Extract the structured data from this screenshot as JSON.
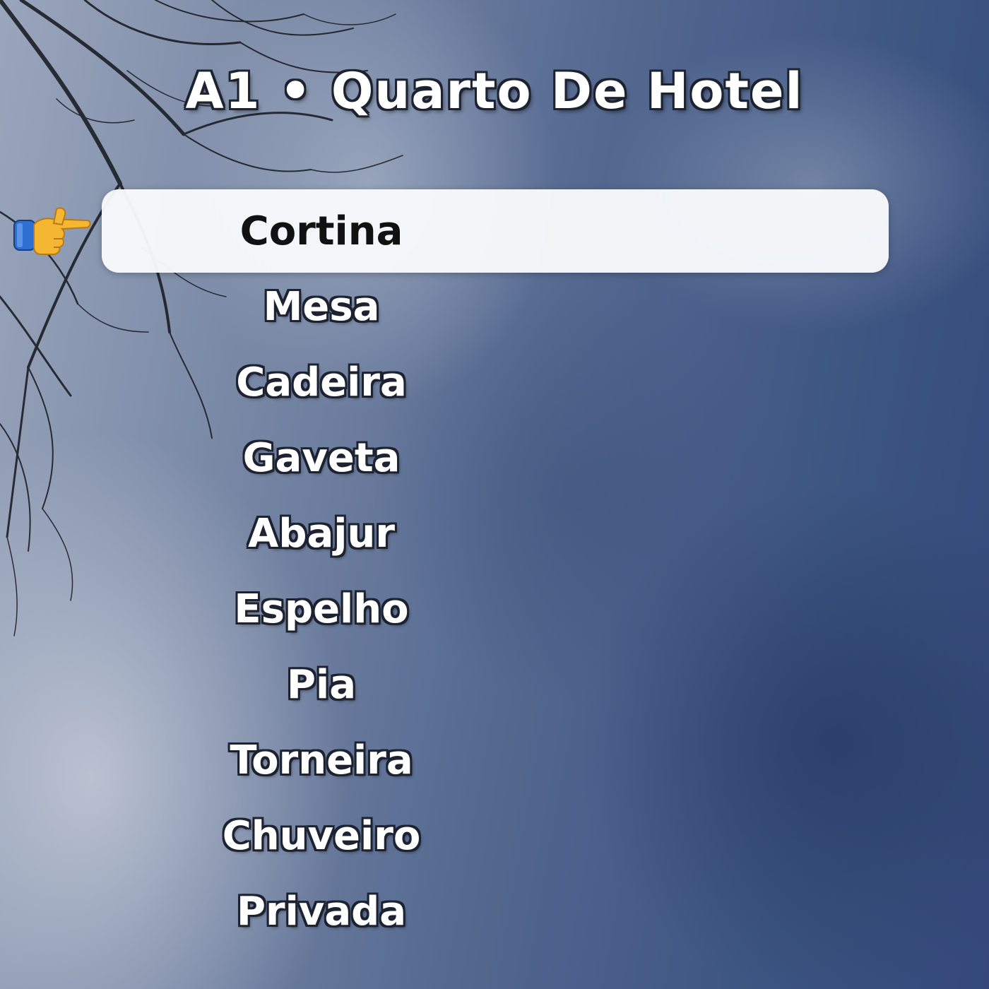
{
  "menu": {
    "title": "A1 • Quarto De Hotel",
    "selected_index": 0,
    "pointer_icon": "pointing-hand-icon",
    "items": [
      {
        "label": "Cortina"
      },
      {
        "label": "Mesa"
      },
      {
        "label": "Cadeira"
      },
      {
        "label": "Gaveta"
      },
      {
        "label": "Abajur"
      },
      {
        "label": "Espelho"
      },
      {
        "label": "Pia"
      },
      {
        "label": "Torneira"
      },
      {
        "label": "Chuveiro"
      },
      {
        "label": "Privada"
      }
    ]
  },
  "colors": {
    "highlight": "#f8f9fb",
    "selected_text": "#111111",
    "item_text": "#ffffff",
    "outline": "#1c2230"
  }
}
